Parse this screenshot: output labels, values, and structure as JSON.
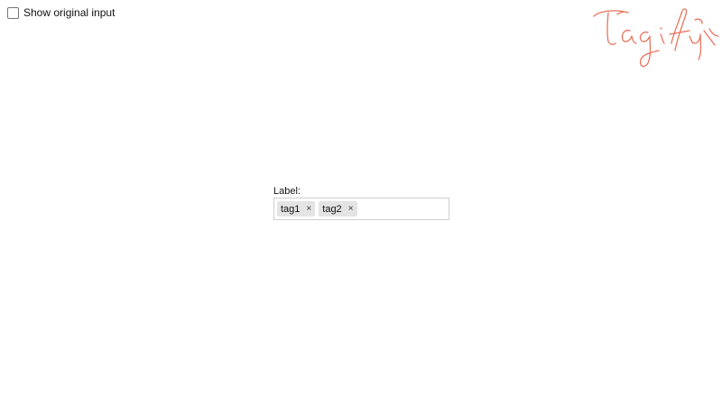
{
  "header": {
    "show_original_label": "Show original input",
    "show_original_checked": false
  },
  "logo": {
    "name": "Tagify-logo",
    "text": "Tagify",
    "color": "#e8735c"
  },
  "field": {
    "label": "Label:",
    "tags": [
      {
        "text": "tag1",
        "remove_symbol": "×"
      },
      {
        "text": "tag2",
        "remove_symbol": "×"
      }
    ],
    "input_value": ""
  }
}
